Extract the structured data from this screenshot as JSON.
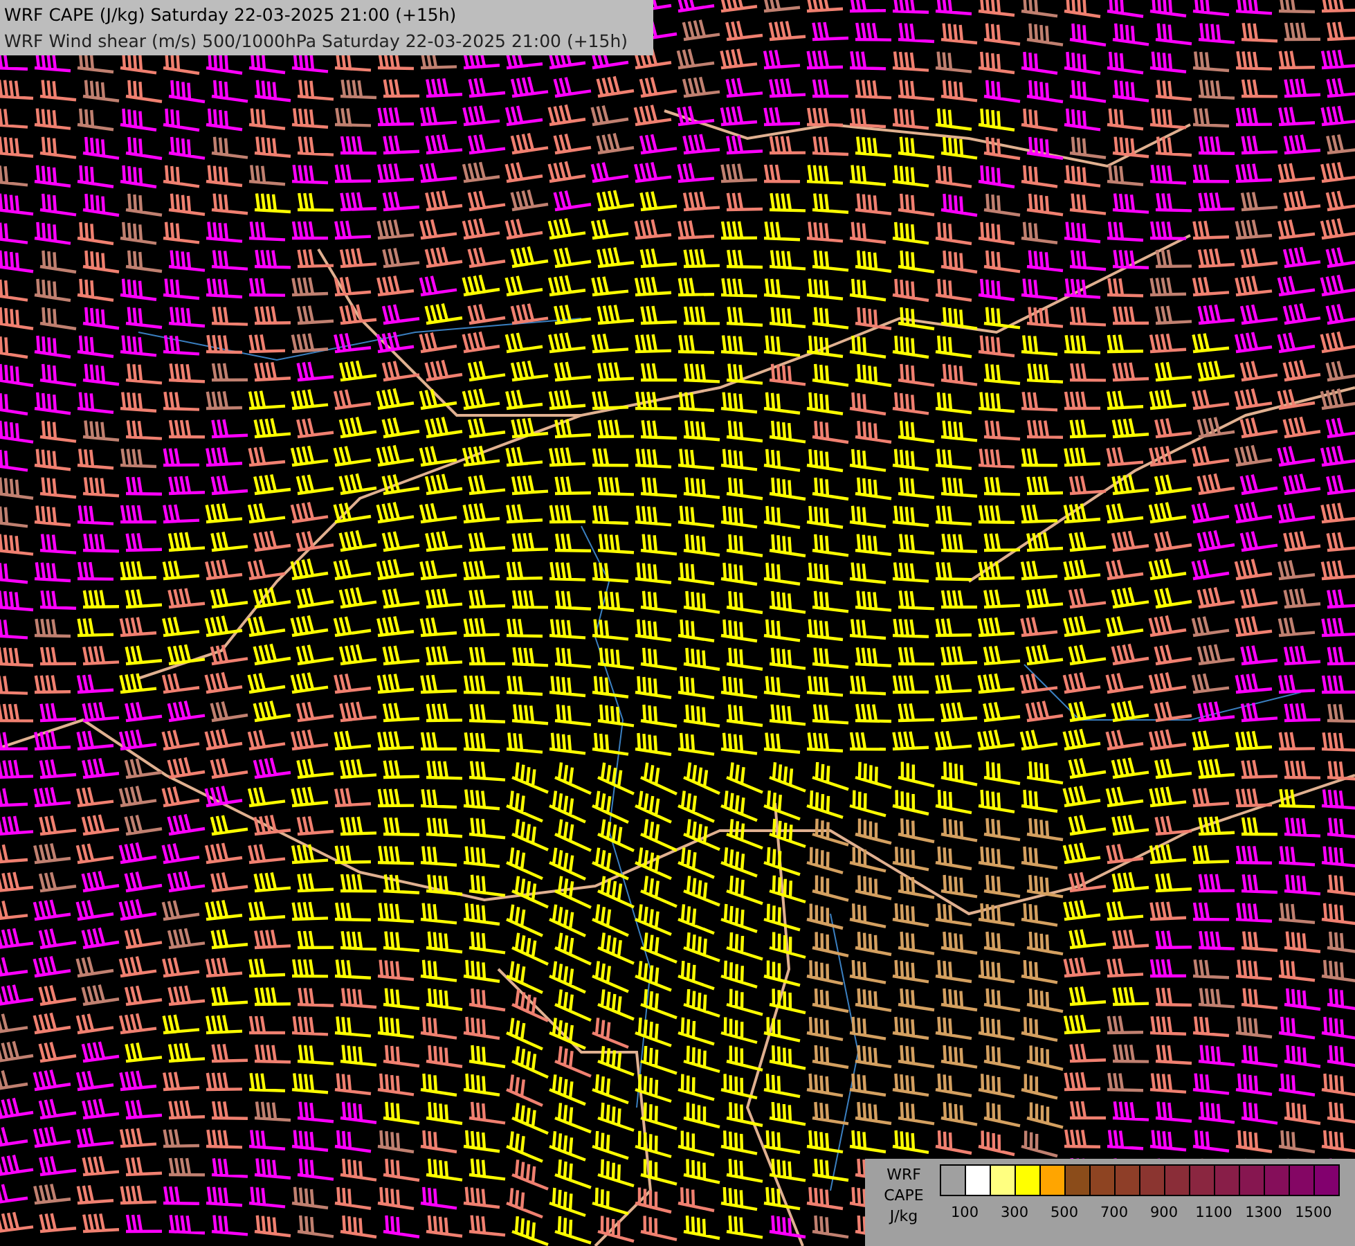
{
  "title_lines": [
    "WRF CAPE (J/kg) Saturday 22-03-2025 21:00 (+15h)",
    "WRF Wind shear (m/s) 500/1000hPa Saturday 22-03-2025 21:00 (+15h)"
  ],
  "legend": {
    "labels": [
      "WRF",
      "CAPE",
      "J/kg"
    ],
    "bins": [
      {
        "kind": "empty"
      },
      {
        "kind": "filled",
        "color": "#ffffff"
      },
      {
        "kind": "filled",
        "color": "#ffff80"
      },
      {
        "kind": "filled",
        "color": "#ffff00"
      },
      {
        "kind": "filled",
        "color": "#ffa500"
      },
      {
        "kind": "filled",
        "color": "#8b4c1a"
      },
      {
        "kind": "filled",
        "color": "#8e4422"
      },
      {
        "kind": "filled",
        "color": "#8e3e28"
      },
      {
        "kind": "filled",
        "color": "#8b3530"
      },
      {
        "kind": "filled",
        "color": "#8a2d38"
      },
      {
        "kind": "filled",
        "color": "#8a2640"
      },
      {
        "kind": "filled",
        "color": "#881e48"
      },
      {
        "kind": "filled",
        "color": "#861650"
      },
      {
        "kind": "filled",
        "color": "#850e5a"
      },
      {
        "kind": "filled",
        "color": "#840664"
      },
      {
        "kind": "filled",
        "color": "#82006e"
      }
    ],
    "ticks": [
      "100",
      "300",
      "500",
      "700",
      "900",
      "1100",
      "1300",
      "1500"
    ]
  }
}
